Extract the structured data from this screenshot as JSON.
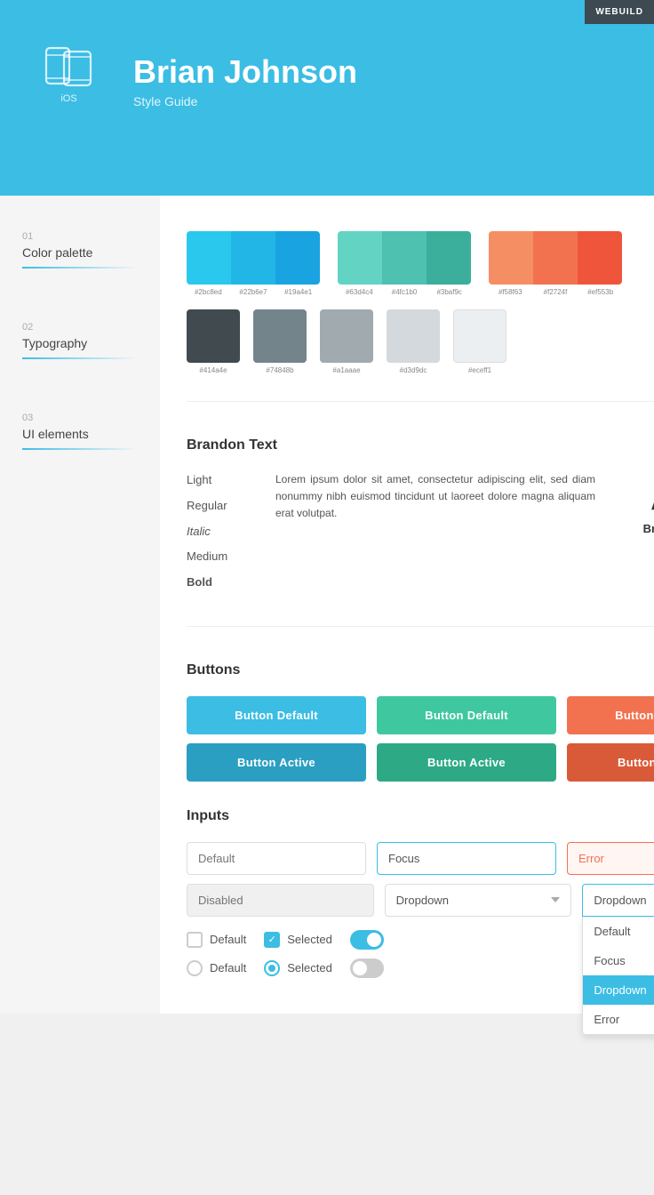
{
  "header": {
    "badge": "WEBUILD",
    "device_label": "iOS",
    "name": "Brian Johnson",
    "subtitle": "Style Guide"
  },
  "sidebar": {
    "sections": [
      {
        "number": "01",
        "title": "Color palette"
      },
      {
        "number": "02",
        "title": "Typography"
      },
      {
        "number": "03",
        "title": "UI elements"
      }
    ]
  },
  "color_palette": {
    "groups": [
      {
        "swatches": [
          "#2bc8ed",
          "#22b6e7",
          "#19a4e1"
        ],
        "labels": [
          "#2bc8ed",
          "#22b6e7",
          "#19a4e1"
        ]
      },
      {
        "swatches": [
          "#63d4c4",
          "#4fc1b0",
          "#3baf9c"
        ],
        "labels": [
          "#63d4c4",
          "#4fc1b0",
          "#3baf9c"
        ]
      },
      {
        "swatches": [
          "#f58f63",
          "#f2724f",
          "#ef553b"
        ],
        "labels": [
          "#f58f63",
          "#f2724f",
          "#ef553b"
        ]
      }
    ],
    "neutrals": [
      {
        "color": "#414a4e",
        "label": "#414a4e"
      },
      {
        "color": "#74848b",
        "label": "#74848b"
      },
      {
        "color": "#a1aaae",
        "label": "#a1aaae"
      },
      {
        "color": "#d3d9dc",
        "label": "#d3d9dc"
      },
      {
        "color": "#eceff1",
        "label": "#eceff1"
      }
    ]
  },
  "typography": {
    "title": "Brandon Text",
    "variants": [
      "Light",
      "Regular",
      "Italic",
      "Medium",
      "Bold"
    ],
    "sample_text": "Lorem ipsum dolor sit amet, consectetur adipiscing elit, sed diam nonummy nibh euismod tincidunt ut laoreet dolore magna aliquam erat volutpat.",
    "showcase_aa": "Aa",
    "showcase_name": "Brandon Text"
  },
  "ui_elements": {
    "buttons_title": "Buttons",
    "button_rows": [
      [
        {
          "label": "Button Default",
          "style": "blue"
        },
        {
          "label": "Button Default",
          "style": "teal"
        },
        {
          "label": "Button Default",
          "style": "orange"
        }
      ],
      [
        {
          "label": "Button Active",
          "style": "blue-dark"
        },
        {
          "label": "Button Active",
          "style": "teal-dark"
        },
        {
          "label": "Button Active",
          "style": "orange-dark"
        }
      ]
    ],
    "inputs_title": "Inputs",
    "inputs": {
      "default_placeholder": "Default",
      "focus_value": "Focus",
      "error_value": "Error",
      "disabled_placeholder": "Disabled",
      "dropdown_label": "Dropdown",
      "dropdown_options": [
        "Default",
        "Focus",
        "Dropdown",
        "Error"
      ]
    },
    "checkboxes": [
      {
        "label": "Default",
        "checked": false
      },
      {
        "label": "Selected",
        "checked": true
      }
    ],
    "toggles": [
      {
        "state": "on"
      },
      {
        "state": "off"
      }
    ],
    "radios": [
      {
        "label": "Default",
        "selected": false
      },
      {
        "label": "Selected",
        "selected": true
      }
    ]
  }
}
